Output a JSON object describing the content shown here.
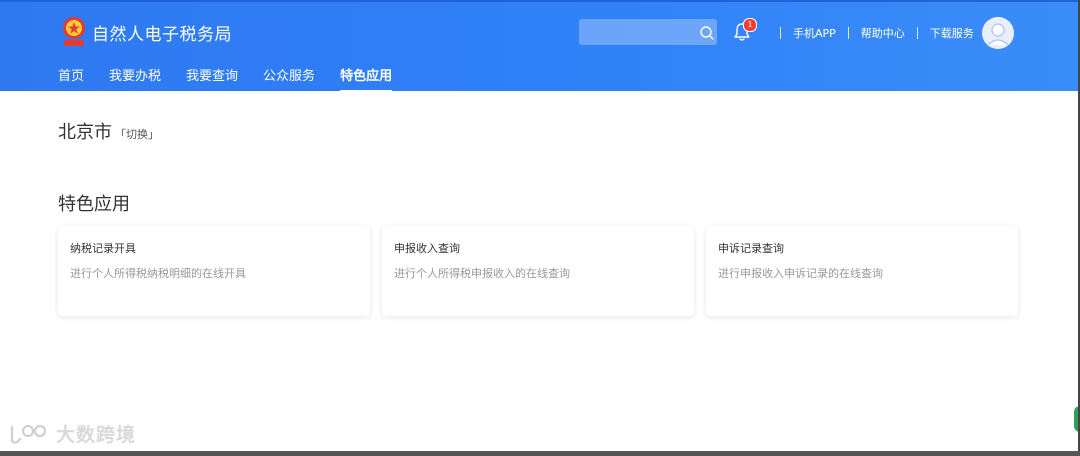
{
  "header": {
    "site_title": "自然人电子税务局",
    "search": {
      "placeholder": "",
      "value": ""
    },
    "notifications": {
      "count": "1"
    },
    "links": [
      {
        "label": "手机APP"
      },
      {
        "label": "帮助中心"
      },
      {
        "label": "下载服务"
      }
    ],
    "nav": [
      {
        "label": "首页",
        "active": false
      },
      {
        "label": "我要办税",
        "active": false
      },
      {
        "label": "我要查询",
        "active": false
      },
      {
        "label": "公众服务",
        "active": false
      },
      {
        "label": "特色应用",
        "active": true
      }
    ],
    "colors": {
      "header_blue": "#2f7ff7",
      "badge_red": "#ff3b30"
    }
  },
  "location": {
    "city": "北京市",
    "switch_label": "「切换」"
  },
  "section": {
    "title": "特色应用",
    "cards": [
      {
        "title": "纳税记录开具",
        "description": "进行个人所得税纳税明细的在线开具"
      },
      {
        "title": "申报收入查询",
        "description": "进行个人所得税申报收入的在线查询"
      },
      {
        "title": "申诉记录查询",
        "description": "进行申报收入申诉记录的在线查询"
      }
    ]
  },
  "watermark": {
    "text": "大数跨境"
  },
  "icons": {
    "logo": "tax-emblem-icon",
    "search": "search-icon",
    "bell": "bell-icon",
    "avatar": "user-avatar-icon"
  }
}
